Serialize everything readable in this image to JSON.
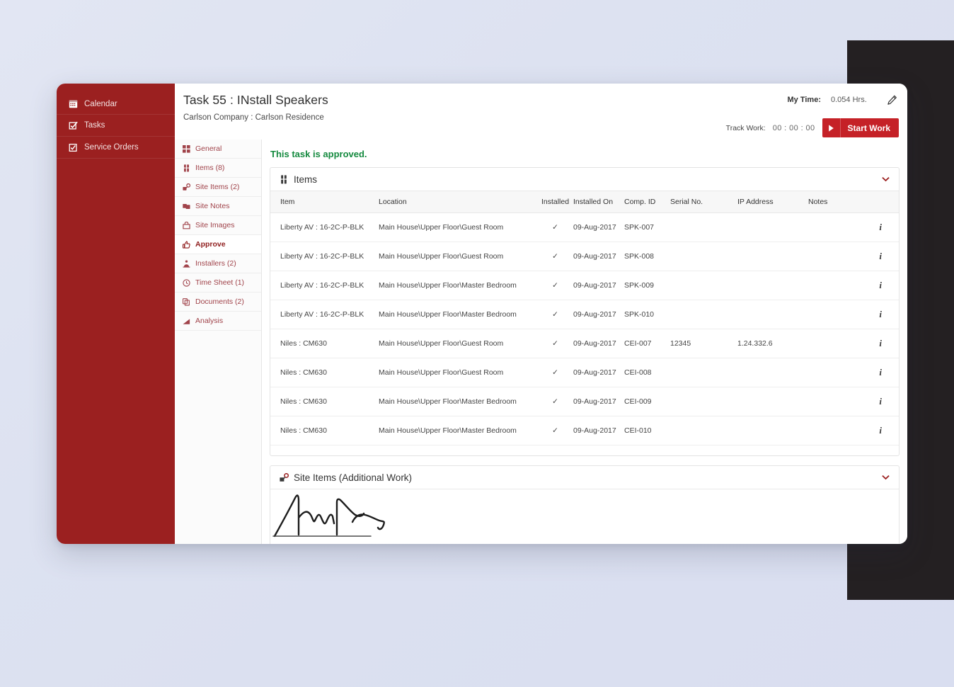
{
  "sidebar": {
    "items": [
      {
        "label": "Calendar",
        "icon": "calendar-icon"
      },
      {
        "label": "Tasks",
        "icon": "checklist-icon"
      },
      {
        "label": "Service Orders",
        "icon": "check-square-icon"
      }
    ]
  },
  "header": {
    "title": "Task 55 : INstall Speakers",
    "subtitle": "Carlson Company : Carlson Residence",
    "my_time_label": "My Time:",
    "my_time_value": "0.054 Hrs.",
    "edit_icon": "pencil-icon",
    "track_work_label": "Track Work:",
    "track_work_time": "00 : 00 : 00",
    "start_work_label": "Start Work",
    "play_icon": "play-icon"
  },
  "tabs": [
    {
      "label": "General",
      "icon": "grid-icon",
      "active": false
    },
    {
      "label": "Items (8)",
      "icon": "items-icon",
      "active": false
    },
    {
      "label": "Site Items (2)",
      "icon": "site-items-icon",
      "active": false
    },
    {
      "label": "Site Notes",
      "icon": "notes-icon",
      "active": false
    },
    {
      "label": "Site Images",
      "icon": "image-icon",
      "active": false
    },
    {
      "label": "Approve",
      "icon": "thumbs-up-icon",
      "active": true
    },
    {
      "label": "Installers (2)",
      "icon": "installer-icon",
      "active": false
    },
    {
      "label": "Time Sheet (1)",
      "icon": "clock-icon",
      "active": false
    },
    {
      "label": "Documents (2)",
      "icon": "documents-icon",
      "active": false
    },
    {
      "label": "Analysis",
      "icon": "chart-icon",
      "active": false
    }
  ],
  "status_message": "This task is approved.",
  "items_panel": {
    "title": "Items",
    "icon": "items-icon",
    "collapse_icon": "chevron-down-icon",
    "columns": [
      "Item",
      "Location",
      "Installed",
      "Installed On",
      "Comp. ID",
      "Serial No.",
      "IP Address",
      "Notes"
    ],
    "rows": [
      {
        "item": "Liberty AV : 16-2C-P-BLK",
        "location": "Main House\\Upper Floor\\Guest Room",
        "installed": "✓",
        "installed_on": "09-Aug-2017",
        "comp_id": "SPK-007",
        "serial": "",
        "ip": "",
        "notes_icon": "info-icon"
      },
      {
        "item": "Liberty AV : 16-2C-P-BLK",
        "location": "Main House\\Upper Floor\\Guest Room",
        "installed": "✓",
        "installed_on": "09-Aug-2017",
        "comp_id": "SPK-008",
        "serial": "",
        "ip": "",
        "notes_icon": "info-icon"
      },
      {
        "item": "Liberty AV : 16-2C-P-BLK",
        "location": "Main House\\Upper Floor\\Master Bedroom",
        "installed": "✓",
        "installed_on": "09-Aug-2017",
        "comp_id": "SPK-009",
        "serial": "",
        "ip": "",
        "notes_icon": "info-icon"
      },
      {
        "item": "Liberty AV : 16-2C-P-BLK",
        "location": "Main House\\Upper Floor\\Master Bedroom",
        "installed": "✓",
        "installed_on": "09-Aug-2017",
        "comp_id": "SPK-010",
        "serial": "",
        "ip": "",
        "notes_icon": "info-icon"
      },
      {
        "item": "Niles : CM630",
        "location": "Main House\\Upper Floor\\Guest Room",
        "installed": "✓",
        "installed_on": "09-Aug-2017",
        "comp_id": "CEI-007",
        "serial": "12345",
        "ip": "1.24.332.6",
        "notes_icon": "info-icon"
      },
      {
        "item": "Niles : CM630",
        "location": "Main House\\Upper Floor\\Guest Room",
        "installed": "✓",
        "installed_on": "09-Aug-2017",
        "comp_id": "CEI-008",
        "serial": "",
        "ip": "",
        "notes_icon": "info-icon"
      },
      {
        "item": "Niles : CM630",
        "location": "Main House\\Upper Floor\\Master Bedroom",
        "installed": "✓",
        "installed_on": "09-Aug-2017",
        "comp_id": "CEI-009",
        "serial": "",
        "ip": "",
        "notes_icon": "info-icon"
      },
      {
        "item": "Niles : CM630",
        "location": "Main House\\Upper Floor\\Master Bedroom",
        "installed": "✓",
        "installed_on": "09-Aug-2017",
        "comp_id": "CEI-010",
        "serial": "",
        "ip": "",
        "notes_icon": "info-icon"
      }
    ]
  },
  "site_items_panel": {
    "title": "Site Items (Additional Work)",
    "icon": "site-items-icon",
    "collapse_icon": "chevron-down-icon",
    "signature": "handwritten-signature"
  },
  "colors": {
    "brand_red": "#9b2020",
    "action_red": "#c52127",
    "approved_green": "#158a3f",
    "page_bg": "#dde2f1",
    "dark_panel": "#242022"
  }
}
